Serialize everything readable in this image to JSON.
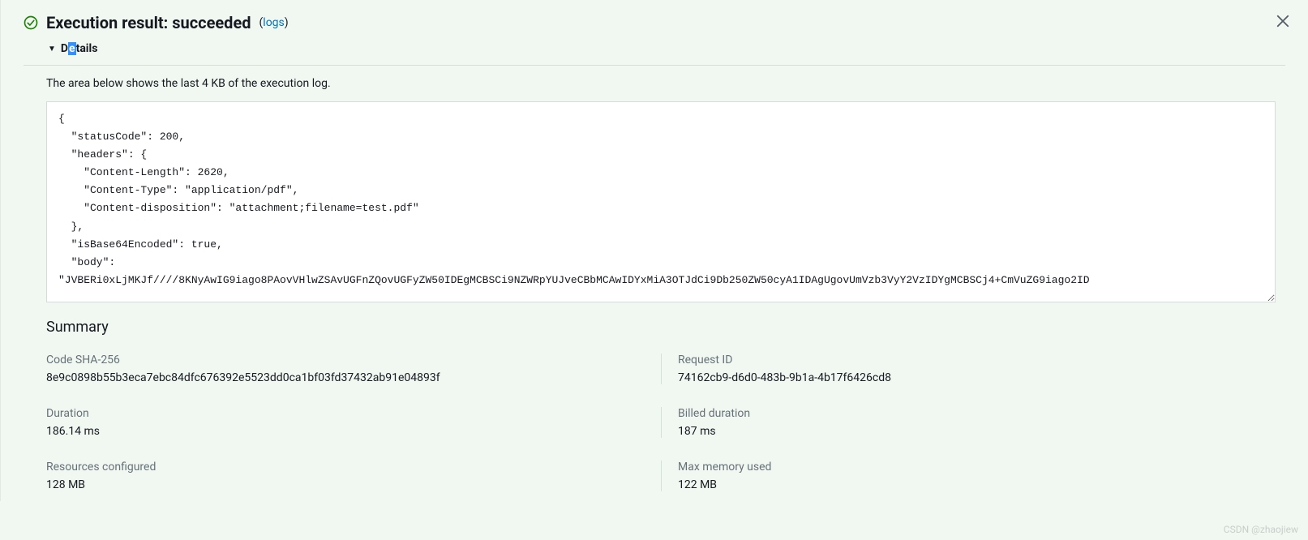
{
  "header": {
    "title": "Execution result: succeeded",
    "logs_link": "logs"
  },
  "details": {
    "toggle_label_prefix": "D",
    "toggle_label_highlight": "e",
    "toggle_label_suffix": "tails"
  },
  "log": {
    "subtitle": "The area below shows the last 4 KB of the execution log.",
    "content": "{\n  \"statusCode\": 200,\n  \"headers\": {\n    \"Content-Length\": 2620,\n    \"Content-Type\": \"application/pdf\",\n    \"Content-disposition\": \"attachment;filename=test.pdf\"\n  },\n  \"isBase64Encoded\": true,\n  \"body\": \n\"JVBERi0xLjMKJf////8KNyAwIG9iago8PAovVHlwZSAvUGFnZQovUGFyZW50IDEgMCBSCi9NZWRpYUJveCBbMCAwIDYxMiA3OTJdCi9Db250ZW50cyA1IDAgUgovUmVzb3VyY2VzIDYgMCBSCj4+CmVuZG9iago2ID"
  },
  "summary": {
    "title": "Summary",
    "items": [
      {
        "label": "Code SHA-256",
        "value": "8e9c0898b55b3eca7ebc84dfc676392e5523dd0ca1bf03fd37432ab91e04893f",
        "col": "left"
      },
      {
        "label": "Request ID",
        "value": "74162cb9-d6d0-483b-9b1a-4b17f6426cd8",
        "col": "right"
      },
      {
        "label": "Duration",
        "value": "186.14 ms",
        "col": "left"
      },
      {
        "label": "Billed duration",
        "value": "187 ms",
        "col": "right"
      },
      {
        "label": "Resources configured",
        "value": "128 MB",
        "col": "left"
      },
      {
        "label": "Max memory used",
        "value": "122 MB",
        "col": "right"
      }
    ]
  },
  "watermark": "CSDN @zhaojiew"
}
